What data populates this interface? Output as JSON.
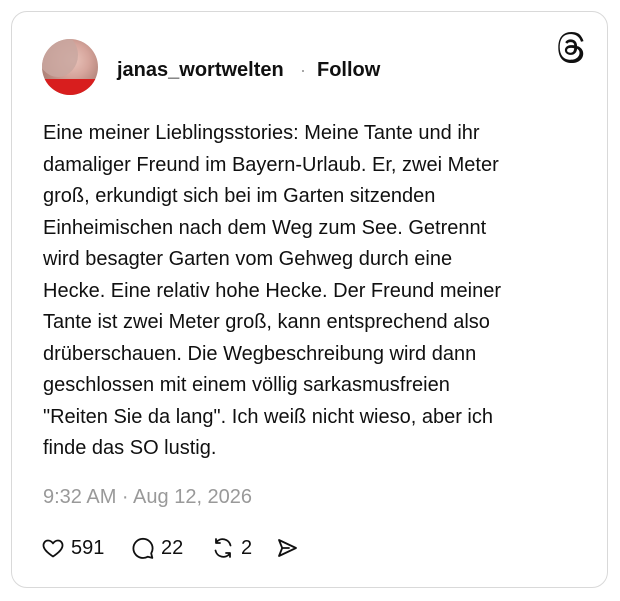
{
  "post": {
    "username": "janas_wortwelten",
    "separator": "·",
    "follow_label": "Follow",
    "text": "Eine meiner Lieblingsstories: Meine Tante und ihr\ndamaliger Freund im Bayern-Urlaub. Er, zwei Meter\ngroß, erkundigt sich bei im Garten sitzenden\nEinheimischen nach dem Weg zum See. Getrennt\nwird besagter Garten vom Gehweg durch eine\nHecke. Eine relativ hohe Hecke. Der Freund meiner\nTante ist zwei Meter groß, kann entsprechend also\ndrüberschauen. Die Wegbeschreibung wird dann\ngeschlossen mit einem völlig sarkasmusfreien\n\"Reiten Sie da lang\". Ich weiß nicht wieso, aber ich\nfinde das SO lustig.",
    "timestamp": "9:32 AM · Aug 12, 2026"
  },
  "actions": {
    "likes": "591",
    "replies": "22",
    "reposts": "2"
  },
  "icons": {
    "brand": "threads-icon",
    "like": "heart-icon",
    "reply": "speech-bubble-icon",
    "repost": "repost-icon",
    "share": "send-icon"
  },
  "colors": {
    "text": "#101010",
    "muted": "#999999",
    "border": "#d9d9d9",
    "background": "#ffffff"
  }
}
